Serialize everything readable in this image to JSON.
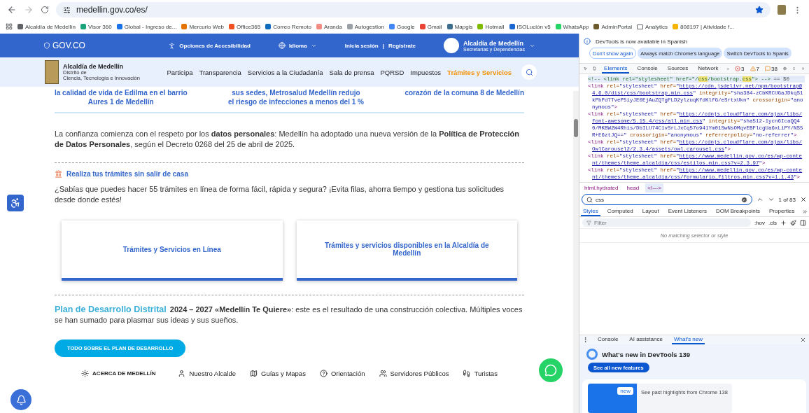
{
  "browser": {
    "url": "medellin.gov.co/es/",
    "bookmarks": [
      {
        "label": "Alcaldía de Medellín",
        "kind": "site",
        "color": "#5f6368"
      },
      {
        "label": "Visor 360",
        "kind": "site",
        "color": "#1aa37a"
      },
      {
        "label": "Global - Ingreso de...",
        "kind": "site",
        "color": "#1a73e8"
      },
      {
        "label": "Mercurio Web",
        "kind": "site",
        "color": "#e37400"
      },
      {
        "label": "Office365",
        "kind": "site",
        "color": "#f25022"
      },
      {
        "label": "Correo Remoto",
        "kind": "site",
        "color": "#0f6cbd"
      },
      {
        "label": "Aranda",
        "kind": "site",
        "color": "#f28b82"
      },
      {
        "label": "Autogestion",
        "kind": "site",
        "color": "#9aa0a6"
      },
      {
        "label": "Google",
        "kind": "site",
        "color": "#4285f4"
      },
      {
        "label": "Gmail",
        "kind": "site",
        "color": "#ea4335"
      },
      {
        "label": "Mapgis",
        "kind": "site",
        "color": "#3c6e8f"
      },
      {
        "label": "Hotmail",
        "kind": "site",
        "color": "#7fba00"
      },
      {
        "label": "ISOLución v5",
        "kind": "site",
        "color": "#1967d2"
      },
      {
        "label": "WhatsApp",
        "kind": "site",
        "color": "#25d366"
      },
      {
        "label": "AdminPortal",
        "kind": "site",
        "color": "#6d5b2e"
      },
      {
        "label": "Analytics",
        "kind": "folder",
        "color": "#5f6368"
      },
      {
        "label": "808197 | Atividade f...",
        "kind": "site",
        "color": "#f4b400"
      }
    ]
  },
  "site": {
    "topbar": {
      "logo": "GOV.CO",
      "accessibility": "Opciones de Accesibilidad",
      "language": "Idioma",
      "login": "Inicia sesión",
      "separator": "|",
      "register": "Regístrate",
      "entity_name": "Alcaldía de Medellín",
      "entity_sub": "Secretarías y Dependencias"
    },
    "nav": {
      "brand": "Alcaldía de Medellín",
      "brand_sub_1": "Distrito de",
      "brand_sub_2": "Ciencia, Tecnología e Innovación",
      "items": [
        {
          "label": "Participa",
          "selected": false
        },
        {
          "label": "Transparencia",
          "selected": false
        },
        {
          "label": "Servicios a la Ciudadanía",
          "selected": false
        },
        {
          "label": "Sala de prensa",
          "selected": false
        },
        {
          "label": "PQRSD",
          "selected": false
        },
        {
          "label": "Impuestos",
          "selected": false
        },
        {
          "label": "Trámites y Servicios",
          "selected": true
        }
      ]
    },
    "news_snippets": [
      {
        "lines": [
          "la calidad de vida de Edilma en el barrio",
          "Aures 1 de Medellín"
        ]
      },
      {
        "lines": [
          "sus sedes, Metrosalud Medellín redujo",
          "el riesgo de infecciones a menos del 1 %"
        ]
      },
      {
        "lines": [
          "corazón de la comuna 8 de Medellín"
        ]
      }
    ],
    "privacy_text": "La confianza comienza con el respeto por los **datos personales**: Medellín ha adoptado una nueva versión de la **Política de Protección de Datos Personales**, según el Decreto 0268 del 25 de abril de 2025.",
    "tramites": {
      "heading": "Realiza tus trámites sin salir de casa",
      "text": "¿Sabías que puedes hacer 55 trámites en línea de forma fácil, rápida y segura? ¡Evita filas, ahorra tiempo y gestiona tus solicitudes desde donde estés!",
      "cards": [
        "Trámites y Servicios en Línea",
        "Trámites y servicios disponibles en la Alcaldía de Medellín"
      ]
    },
    "plan": {
      "title": "Plan de Desarrollo Distrital",
      "text": "**2024 – 2027 «Medellín Te Quiere»**: este es el resultado de una construcción colectiva. Múltiples voces se han sumado para plasmar sus ideas y sus sueños.",
      "button": "TODO SOBRE EL PLAN DE DESARROLLO"
    },
    "footer_links": [
      {
        "label": "ACERCA DE MEDELLÍN",
        "kind": "heading"
      },
      {
        "label": "Nuestro Alcalde",
        "kind": "person"
      },
      {
        "label": "Guías y Mapas",
        "kind": "map"
      },
      {
        "label": "Orientación",
        "kind": "help"
      },
      {
        "label": "Servidores Públicos",
        "kind": "group"
      },
      {
        "label": "Turistas",
        "kind": "walker"
      }
    ]
  },
  "devtools": {
    "infobar": {
      "message": "DevTools is now available in Spanish",
      "buttons": [
        "Don't show again",
        "Always match Chrome's language",
        "Switch DevTools to Spanis"
      ]
    },
    "tabs": [
      {
        "label": "Elements",
        "selected": true
      },
      {
        "label": "Console",
        "selected": false
      },
      {
        "label": "Sources",
        "selected": false
      },
      {
        "label": "Network",
        "selected": false
      }
    ],
    "counts": {
      "errors": "3",
      "warnings": "7",
      "issues": "38"
    },
    "dom_lines": [
      [
        {
          "kind": "comment",
          "text": "<!-- <link rel=\"stylesheet\" href=\"/"
        },
        {
          "kind": "match",
          "text": "css"
        },
        {
          "kind": "comment",
          "text": "/bootstrap."
        },
        {
          "kind": "match",
          "text": "css"
        },
        {
          "kind": "comment",
          "text": "\"> -->"
        },
        {
          "kind": "plain",
          "text": " == $0"
        }
      ],
      [
        {
          "kind": "tag",
          "text": "<link "
        },
        {
          "kind": "attr",
          "text": "rel="
        },
        {
          "kind": "val",
          "text": "\"stylesheet\" "
        },
        {
          "kind": "attr",
          "text": "href="
        },
        {
          "kind": "val",
          "text": "\""
        },
        {
          "kind": "link",
          "text": "https://cdn.jsdelivr.net/npm/bootstrap@4.6.0/dist/css/bootstrap.min.css"
        },
        {
          "kind": "val",
          "text": "\" "
        },
        {
          "kind": "attr",
          "text": "integrity="
        },
        {
          "kind": "val",
          "text": "\"sha384-zCbKRCUGaJDkqS1kPbPd7TveP5iyJE0EjAuZQTgFLD2ylzuqKfdKlfG/eSrtxUkn\" "
        },
        {
          "kind": "attr",
          "text": "crossorigin="
        },
        {
          "kind": "val",
          "text": "\"anonymous\""
        },
        {
          "kind": "tag",
          "text": ">"
        }
      ],
      [
        {
          "kind": "tag",
          "text": "<link "
        },
        {
          "kind": "attr",
          "text": "rel="
        },
        {
          "kind": "val",
          "text": "\"stylesheet\" "
        },
        {
          "kind": "attr",
          "text": "href="
        },
        {
          "kind": "val",
          "text": "\""
        },
        {
          "kind": "link",
          "text": "https://cdnjs.cloudflare.com/ajax/libs/font-awesome/5.15.4/css/all.min.css"
        },
        {
          "kind": "val",
          "text": "\" "
        },
        {
          "kind": "attr",
          "text": "integrity="
        },
        {
          "kind": "val",
          "text": "\"sha512-1ycn6IcaQQ40/MKBW2W4Rhis/DbILU74C1vSrLJxCq57o941Ym01SwNsOMqvEBFlcgUa6xLiPY/NS5R+E6ztJQ==\" "
        },
        {
          "kind": "attr",
          "text": "crossorigin="
        },
        {
          "kind": "val",
          "text": "\"anonymous\" "
        },
        {
          "kind": "attr",
          "text": "referrerpolicy="
        },
        {
          "kind": "val",
          "text": "\"no-referrer\""
        },
        {
          "kind": "tag",
          "text": ">"
        }
      ],
      [
        {
          "kind": "tag",
          "text": "<link "
        },
        {
          "kind": "attr",
          "text": "rel="
        },
        {
          "kind": "val",
          "text": "\"stylesheet\" "
        },
        {
          "kind": "attr",
          "text": "href="
        },
        {
          "kind": "val",
          "text": "\""
        },
        {
          "kind": "link",
          "text": "https://cdnjs.cloudflare.com/ajax/libs/OwlCarousel2/2.3.4/assets/owl.carousel.css"
        },
        {
          "kind": "val",
          "text": "\""
        },
        {
          "kind": "tag",
          "text": ">"
        }
      ],
      [
        {
          "kind": "tag",
          "text": "<link "
        },
        {
          "kind": "attr",
          "text": "rel="
        },
        {
          "kind": "val",
          "text": "\"stylesheet\" "
        },
        {
          "kind": "attr",
          "text": "href="
        },
        {
          "kind": "val",
          "text": "\""
        },
        {
          "kind": "link",
          "text": "https://www.medellin.gov.co/es/wp-content/themes/theme_alcaldia/css/estilos.min.css?v=2.3.97"
        },
        {
          "kind": "val",
          "text": "\""
        },
        {
          "kind": "tag",
          "text": ">"
        }
      ],
      [
        {
          "kind": "tag",
          "text": "<link "
        },
        {
          "kind": "attr",
          "text": "rel="
        },
        {
          "kind": "val",
          "text": "\"stylesheet\" "
        },
        {
          "kind": "attr",
          "text": "href="
        },
        {
          "kind": "val",
          "text": "\""
        },
        {
          "kind": "link",
          "text": "https://www.medellin.gov.co/es/wp-content/themes/theme_alcaldia/css/formulario_filtros.min.css?v=1.1.43"
        },
        {
          "kind": "val",
          "text": "\""
        },
        {
          "kind": "tag",
          "text": ">"
        }
      ]
    ],
    "breadcrumbs": [
      {
        "label": "html.hydrated",
        "selected": false
      },
      {
        "label": "head",
        "selected": false
      },
      {
        "label": "<!--->",
        "selected": true
      }
    ],
    "search": {
      "value": "css",
      "result": "1 of 83"
    },
    "styles_tabs": [
      {
        "label": "Styles",
        "selected": true
      },
      {
        "label": "Computed",
        "selected": false
      },
      {
        "label": "Layout",
        "selected": false
      },
      {
        "label": "Event Listeners",
        "selected": false
      },
      {
        "label": "DOM Breakpoints",
        "selected": false
      },
      {
        "label": "Properties",
        "selected": false
      }
    ],
    "filter_placeholder": "Filter",
    "hov": ":hov",
    "cls": ".cls",
    "empty": "No matching selector or style",
    "drawer": {
      "tabs": [
        {
          "label": "Console",
          "selected": false
        },
        {
          "label": "AI assistance",
          "selected": false
        },
        {
          "label": "What's new",
          "selected": true
        }
      ],
      "title": "What's new in DevTools 139",
      "button": "See all new features",
      "badge": "new",
      "highlight": "See past highlights from Chrome 138"
    }
  }
}
